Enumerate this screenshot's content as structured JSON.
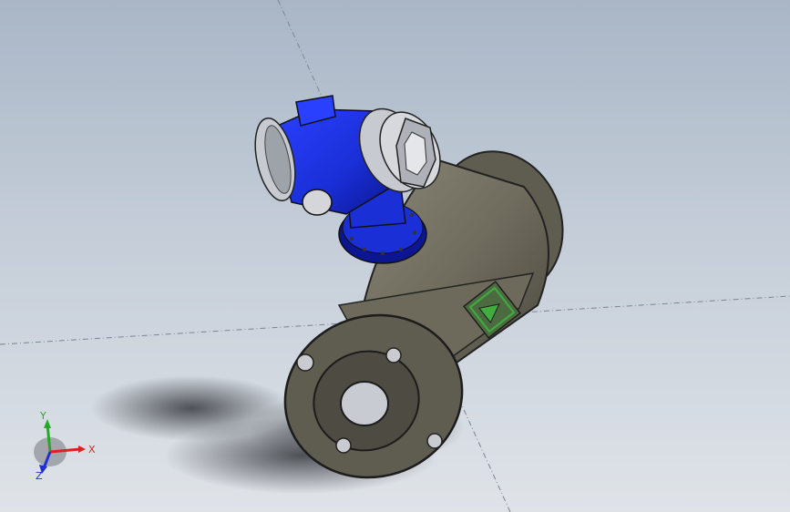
{
  "scene": {
    "subject": "flowmeter-3d-model",
    "colors": {
      "background_top": "#a9b6c6",
      "background_bottom": "#dfe3e8",
      "body_gray": "#6d6a5c",
      "flange_gray": "#5f5c50",
      "housing_blue": "#1a2fd6",
      "housing_blue_dark": "#0b1690",
      "cap_gray": "#b9bdc4",
      "arrow_green": "#3fae3f",
      "shadow": "#3b3e44"
    }
  },
  "triad": {
    "x_label": "X",
    "y_label": "Y",
    "z_label": "Z",
    "colors": {
      "x": "#e02020",
      "y": "#22aa22",
      "z": "#2030d0"
    }
  }
}
